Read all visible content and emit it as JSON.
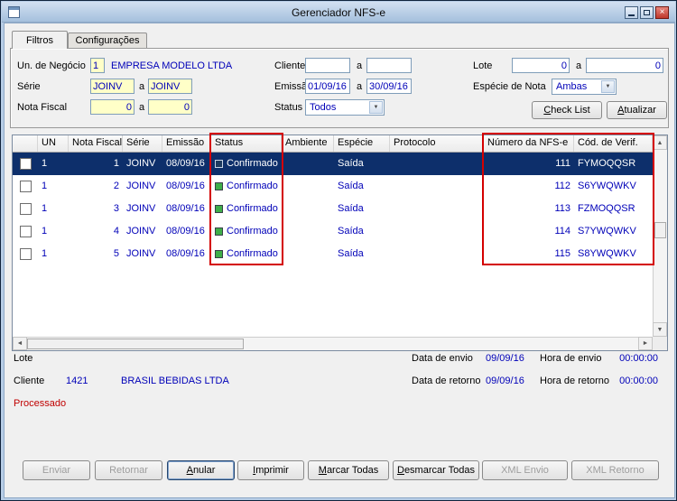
{
  "colors": {
    "selection_bg": "#0d2f6b",
    "value_text": "#0000b8",
    "highlight_box": "#d40000",
    "field_yellow": "#ffffc8",
    "status_green": "#3fae49",
    "status_selected": "#1d3a5f",
    "processado_red": "#c00000"
  },
  "icons": {
    "combo_arrow": "▼",
    "scroll_up": "▲",
    "scroll_down": "▼",
    "scroll_left": "◄",
    "scroll_right": "►",
    "close": "×"
  },
  "window": {
    "title": "Gerenciador NFS-e"
  },
  "tabs": {
    "filtros": "Filtros",
    "configuracoes": "Configurações"
  },
  "filters": {
    "labels": {
      "un_negocio": "Un. de Negócio",
      "serie": "Série",
      "nota_fiscal": "Nota Fiscal",
      "cliente": "Cliente",
      "emissao": "Emissão",
      "status": "Status",
      "lote": "Lote",
      "especie_nota": "Espécie de Nota",
      "range_sep": "a"
    },
    "values": {
      "un_negocio": "1",
      "un_negocio_nome": "EMPRESA MODELO LTDA",
      "serie_de": "JOINV",
      "serie_ate": "JOINV",
      "nota_de": "0",
      "nota_ate": "0",
      "cliente_de": "",
      "cliente_ate": "",
      "emissao_de": "01/09/16",
      "emissao_ate": "30/09/16",
      "status": "Todos",
      "lote_de": "0",
      "lote_ate": "0",
      "especie_nota": "Ambas"
    },
    "actions": {
      "check_list": "Check List",
      "atualizar": "Atualizar"
    }
  },
  "grid": {
    "columns": [
      "",
      "UN",
      "Nota Fiscal",
      "Série",
      "Emissão",
      "Status",
      "Ambiente",
      "Espécie",
      "Protocolo",
      "Número da NFS-e",
      "Cód. de Verif."
    ],
    "rows": [
      {
        "un": "1",
        "nota": "1",
        "serie": "JOINV",
        "emissao": "08/09/16",
        "status": "Confirmado",
        "ambiente": "",
        "especie": "Saída",
        "protocolo": "",
        "numero": "111",
        "cod": "FYMOQQSR",
        "selected": true
      },
      {
        "un": "1",
        "nota": "2",
        "serie": "JOINV",
        "emissao": "08/09/16",
        "status": "Confirmado",
        "ambiente": "",
        "especie": "Saída",
        "protocolo": "",
        "numero": "112",
        "cod": "S6YWQWKV",
        "selected": false
      },
      {
        "un": "1",
        "nota": "3",
        "serie": "JOINV",
        "emissao": "08/09/16",
        "status": "Confirmado",
        "ambiente": "",
        "especie": "Saída",
        "protocolo": "",
        "numero": "113",
        "cod": "FZMOQQSR",
        "selected": false
      },
      {
        "un": "1",
        "nota": "4",
        "serie": "JOINV",
        "emissao": "08/09/16",
        "status": "Confirmado",
        "ambiente": "",
        "especie": "Saída",
        "protocolo": "",
        "numero": "114",
        "cod": "S7YWQWKV",
        "selected": false
      },
      {
        "un": "1",
        "nota": "5",
        "serie": "JOINV",
        "emissao": "08/09/16",
        "status": "Confirmado",
        "ambiente": "",
        "especie": "Saída",
        "protocolo": "",
        "numero": "115",
        "cod": "S8YWQWKV",
        "selected": false
      }
    ]
  },
  "footer": {
    "labels": {
      "lote": "Lote",
      "cliente": "Cliente",
      "data_envio": "Data de envio",
      "hora_envio": "Hora de envio",
      "data_retorno": "Data de retorno",
      "hora_retorno": "Hora de retorno"
    },
    "values": {
      "cliente_codigo": "1421",
      "cliente_nome": "BRASIL BEBIDAS LTDA",
      "data_envio": "09/09/16",
      "hora_envio": "00:00:00",
      "data_retorno": "09/09/16",
      "hora_retorno": "00:00:00",
      "status": "Processado"
    }
  },
  "actions": [
    {
      "label": "Enviar",
      "enabled": false
    },
    {
      "label": "Retornar",
      "enabled": false
    },
    {
      "label": "Anular",
      "enabled": true,
      "default": true
    },
    {
      "label": "Imprimir",
      "enabled": true
    },
    {
      "label": "Marcar Todas",
      "enabled": true
    },
    {
      "label": "Desmarcar Todas",
      "enabled": true
    },
    {
      "label": "XML Envio",
      "enabled": false
    },
    {
      "label": "XML Retorno",
      "enabled": false
    }
  ]
}
